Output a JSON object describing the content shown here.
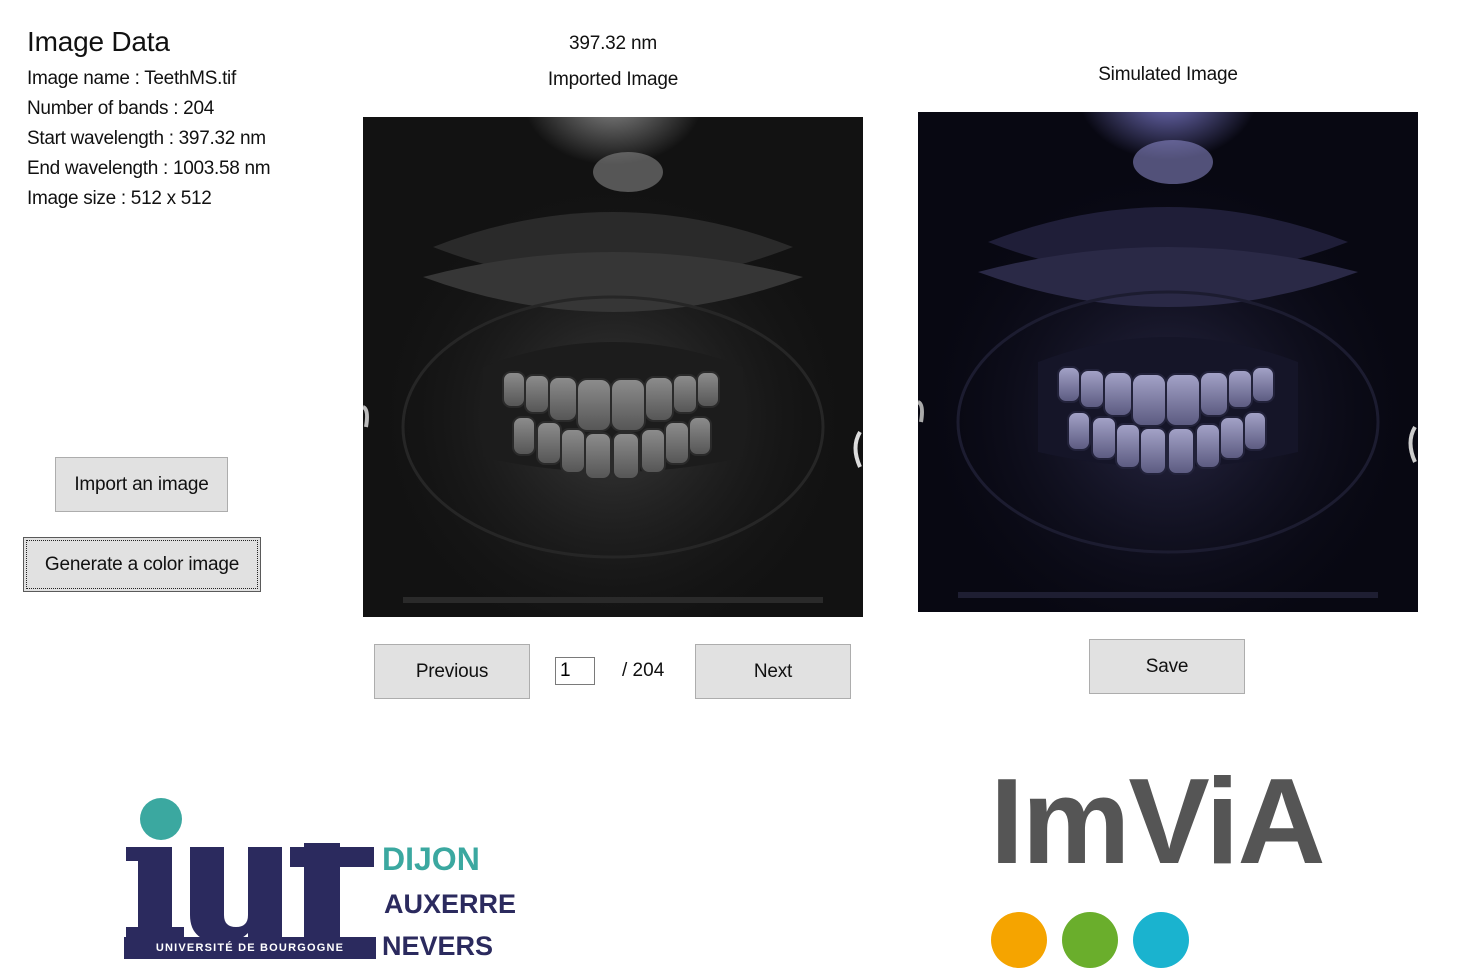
{
  "info": {
    "title": "Image Data",
    "image_name": "Image name : TeethMS.tif",
    "num_bands": "Number of bands : 204",
    "start_wavelength": "Start wavelength : 397.32 nm",
    "end_wavelength": "End wavelength : 1003.58 nm",
    "image_size": "Image size : 512 x 512"
  },
  "buttons": {
    "import": "Import an image",
    "generate": "Generate a color image",
    "previous": "Previous",
    "next": "Next",
    "save": "Save"
  },
  "imported": {
    "wavelength": "397.32 nm",
    "title": "Imported Image"
  },
  "simulated": {
    "title": "Simulated Image"
  },
  "band_nav": {
    "current": "1",
    "total": "/ 204"
  },
  "logos": {
    "iut": {
      "letters": "iut",
      "subtitle": "UNIVERSITÉ DE BOURGOGNE",
      "city1": "DIJON",
      "city2": "AUXERRE",
      "city3": "NEVERS"
    },
    "imvia": {
      "text": "ImViA",
      "dot_colors": [
        "#f5a400",
        "#6aae2c",
        "#1ab3cf"
      ]
    }
  },
  "colors": {
    "iut_navy": "#2b2a5e",
    "iut_teal": "#3ba8a0",
    "imvia_gray": "#555555",
    "button_bg": "#e1e1e1"
  }
}
